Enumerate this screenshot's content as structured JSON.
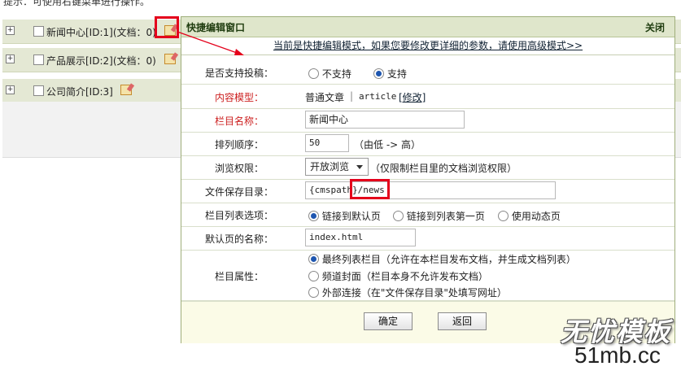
{
  "page": {
    "top_note": "提示：可使用右键菜单进行操作。"
  },
  "tree_rows": [
    {
      "expander": "+",
      "label": "新闻中心[ID:1](文档：0)"
    },
    {
      "expander": "+",
      "label": "产品展示[ID:2](文档：0)"
    },
    {
      "expander": "+",
      "label": "公司简介[ID:3]"
    }
  ],
  "dialog": {
    "title": "快捷编辑窗口",
    "close_label": "关闭",
    "notice": "当前是快捷编辑模式，如果您要修改更详细的参数，请使用高级模式>>",
    "contribute": {
      "label": "是否支持投稿：",
      "options": [
        "不支持",
        "支持"
      ],
      "selected": "支持"
    },
    "content_model": {
      "label": "内容模型：",
      "value": "普通文章",
      "separator": "|",
      "code": "article",
      "modify_link": "[修改]"
    },
    "column_name": {
      "label": "栏目名称：",
      "value": "新闻中心"
    },
    "sort_order": {
      "label": "排列顺序：",
      "value": "50",
      "hint": "（由低 -> 高）"
    },
    "browse_permission": {
      "label": "浏览权限：",
      "selected": "开放浏览",
      "hint": "（仅限制栏目里的文档浏览权限）"
    },
    "save_dir": {
      "label": "文件保存目录：",
      "value": "{cmspath}/news"
    },
    "list_options": {
      "label": "栏目列表选项：",
      "options": [
        "链接到默认页",
        "链接到列表第一页",
        "使用动态页"
      ],
      "selected": "链接到默认页"
    },
    "default_page": {
      "label": "默认页的名称：",
      "value": "index.html"
    },
    "column_property": {
      "label": "栏目属性：",
      "options": [
        "最终列表栏目（允许在本栏目发布文档，并生成文档列表）",
        "频道封面（栏目本身不允许发布文档）",
        "外部连接（在\"文件保存目录\"处填写网址）"
      ],
      "selected": "最终列表栏目（允许在本栏目发布文档，并生成文档列表）"
    },
    "buttons": {
      "ok": "确定",
      "back": "返回"
    }
  },
  "watermark": {
    "brand_cn": "无忧模板",
    "brand_url": "51mb.cc"
  },
  "colors": {
    "highlight_red": "#e4001b",
    "row_bg": "#e4e8d4",
    "dialog_header": "#dfe6cb",
    "required_label": "#cc1f1f"
  }
}
